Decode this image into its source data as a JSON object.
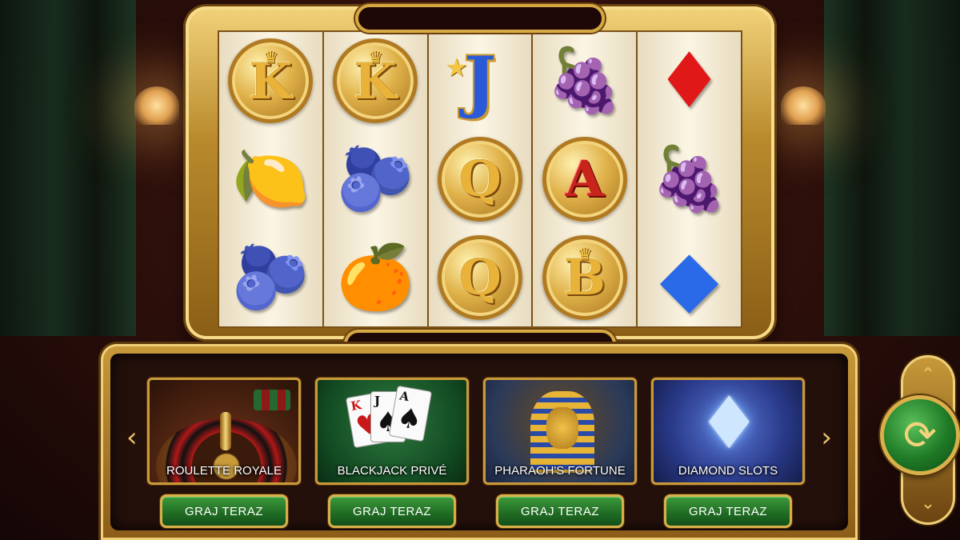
{
  "reels": [
    [
      {
        "kind": "coin",
        "text": "K",
        "crown": true,
        "icon": "king-coin-icon"
      },
      {
        "kind": "fruit",
        "glyph": "🍋",
        "icon": "lemon-icon",
        "color": "#f2d21a"
      },
      {
        "kind": "fruit",
        "glyph": "🫐",
        "icon": "plum-icon",
        "color": "#6a2a8a"
      }
    ],
    [
      {
        "kind": "coin",
        "text": "K",
        "crown": true,
        "icon": "king-coin-icon"
      },
      {
        "kind": "fruit",
        "glyph": "🫐",
        "icon": "plum-icon",
        "color": "#6a2a8a"
      },
      {
        "kind": "fruit",
        "glyph": "🍊",
        "icon": "orange-icon",
        "color": "#f08a1a"
      }
    ],
    [
      {
        "kind": "jack",
        "text": "J",
        "icon": "jack-icon"
      },
      {
        "kind": "coin",
        "text": "Q",
        "icon": "queen-coin-icon"
      },
      {
        "kind": "coin",
        "text": "Q",
        "icon": "queen-coin-icon"
      }
    ],
    [
      {
        "kind": "fruit",
        "glyph": "🍇",
        "icon": "grapes-icon",
        "color": "#4a3ab8"
      },
      {
        "kind": "coin",
        "text": "A",
        "red": true,
        "icon": "ace-coin-icon"
      },
      {
        "kind": "coin",
        "text": "B",
        "crown": true,
        "icon": "bonus-coin-icon"
      }
    ],
    [
      {
        "kind": "gem",
        "glyph": "♦",
        "icon": "ruby-icon",
        "color": "#e01818"
      },
      {
        "kind": "fruit",
        "glyph": "🍇",
        "icon": "grapes-icon",
        "color": "#4a3ab8"
      },
      {
        "kind": "gem",
        "glyph": "◆",
        "icon": "sapphire-icon",
        "color": "#2a6ae8"
      }
    ]
  ],
  "games": [
    {
      "title": "ROULETTE ROYALE",
      "cta": "GRAJ TERAZ"
    },
    {
      "title": "BLACKJACK PRIVÉ",
      "cta": "GRAJ TERAZ"
    },
    {
      "title": "PHARAOH'S FORTUNE",
      "cta": "GRAJ TERAZ"
    },
    {
      "title": "DIAMOND SLOTS",
      "cta": "GRAJ TERAZ"
    }
  ],
  "blackjack_cards": [
    {
      "rank": "K",
      "suit": "♥",
      "color": "#c81818"
    },
    {
      "rank": "J",
      "suit": "♠",
      "color": "#111"
    },
    {
      "rank": "A",
      "suit": "♠",
      "color": "#111"
    }
  ],
  "nav": {
    "prev": "‹",
    "next": "›",
    "up": "⌃",
    "down": "⌄",
    "spin": "⟳"
  }
}
